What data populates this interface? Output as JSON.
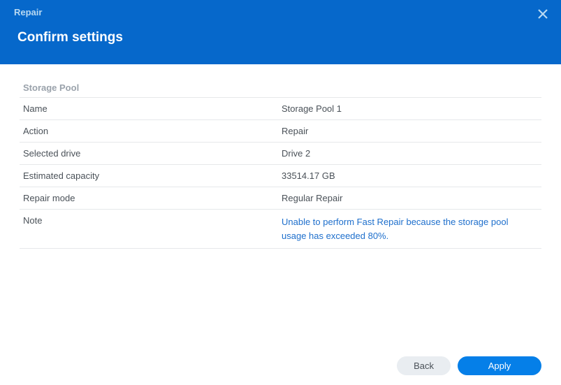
{
  "header": {
    "title": "Repair",
    "subtitle": "Confirm settings"
  },
  "section": {
    "title": "Storage Pool"
  },
  "rows": {
    "name": {
      "label": "Name",
      "value": "Storage Pool 1"
    },
    "action": {
      "label": "Action",
      "value": "Repair"
    },
    "selected_drive": {
      "label": "Selected drive",
      "value": "Drive 2"
    },
    "estimated_capacity": {
      "label": "Estimated capacity",
      "value": "33514.17 GB"
    },
    "repair_mode": {
      "label": "Repair mode",
      "value": "Regular Repair"
    },
    "note": {
      "label": "Note",
      "value": "Unable to perform Fast Repair because the storage pool usage has exceeded 80%."
    }
  },
  "footer": {
    "back": "Back",
    "apply": "Apply"
  }
}
